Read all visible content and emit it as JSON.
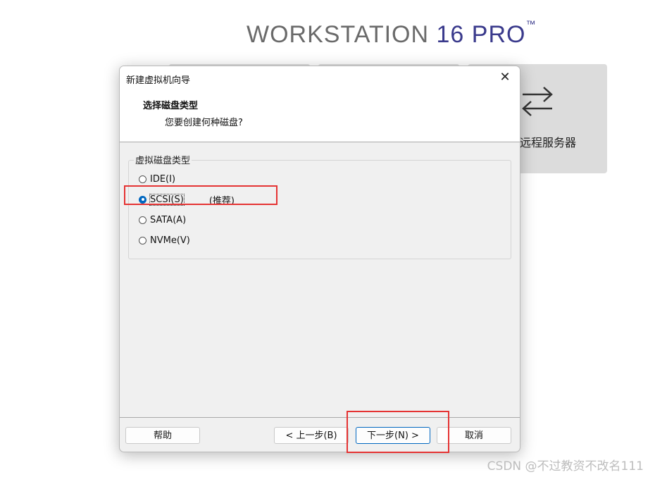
{
  "brand": {
    "word": "WORKSTATION",
    "version": "16",
    "edition": "PRO",
    "tm": "™"
  },
  "background_tile": {
    "label": "远程服务器",
    "icon": "transfer-arrows-icon"
  },
  "dialog": {
    "title": "新建虚拟机向导",
    "close_label": "✕",
    "heading": "选择磁盘类型",
    "subheading": "您要创建何种磁盘?",
    "group_label": "虚拟磁盘类型",
    "options": [
      {
        "label": "IDE(I)",
        "checked": false,
        "note": ""
      },
      {
        "label": "SCSI(S)",
        "checked": true,
        "note": "(推荐)"
      },
      {
        "label": "SATA(A)",
        "checked": false,
        "note": ""
      },
      {
        "label": "NVMe(V)",
        "checked": false,
        "note": ""
      }
    ],
    "buttons": {
      "help": "帮助",
      "back": "< 上一步(B)",
      "next": "下一步(N) >",
      "cancel": "取消"
    }
  },
  "colors": {
    "highlight": "#e53333",
    "accent": "#0067c0"
  },
  "watermark": "CSDN @不过教资不改名111"
}
